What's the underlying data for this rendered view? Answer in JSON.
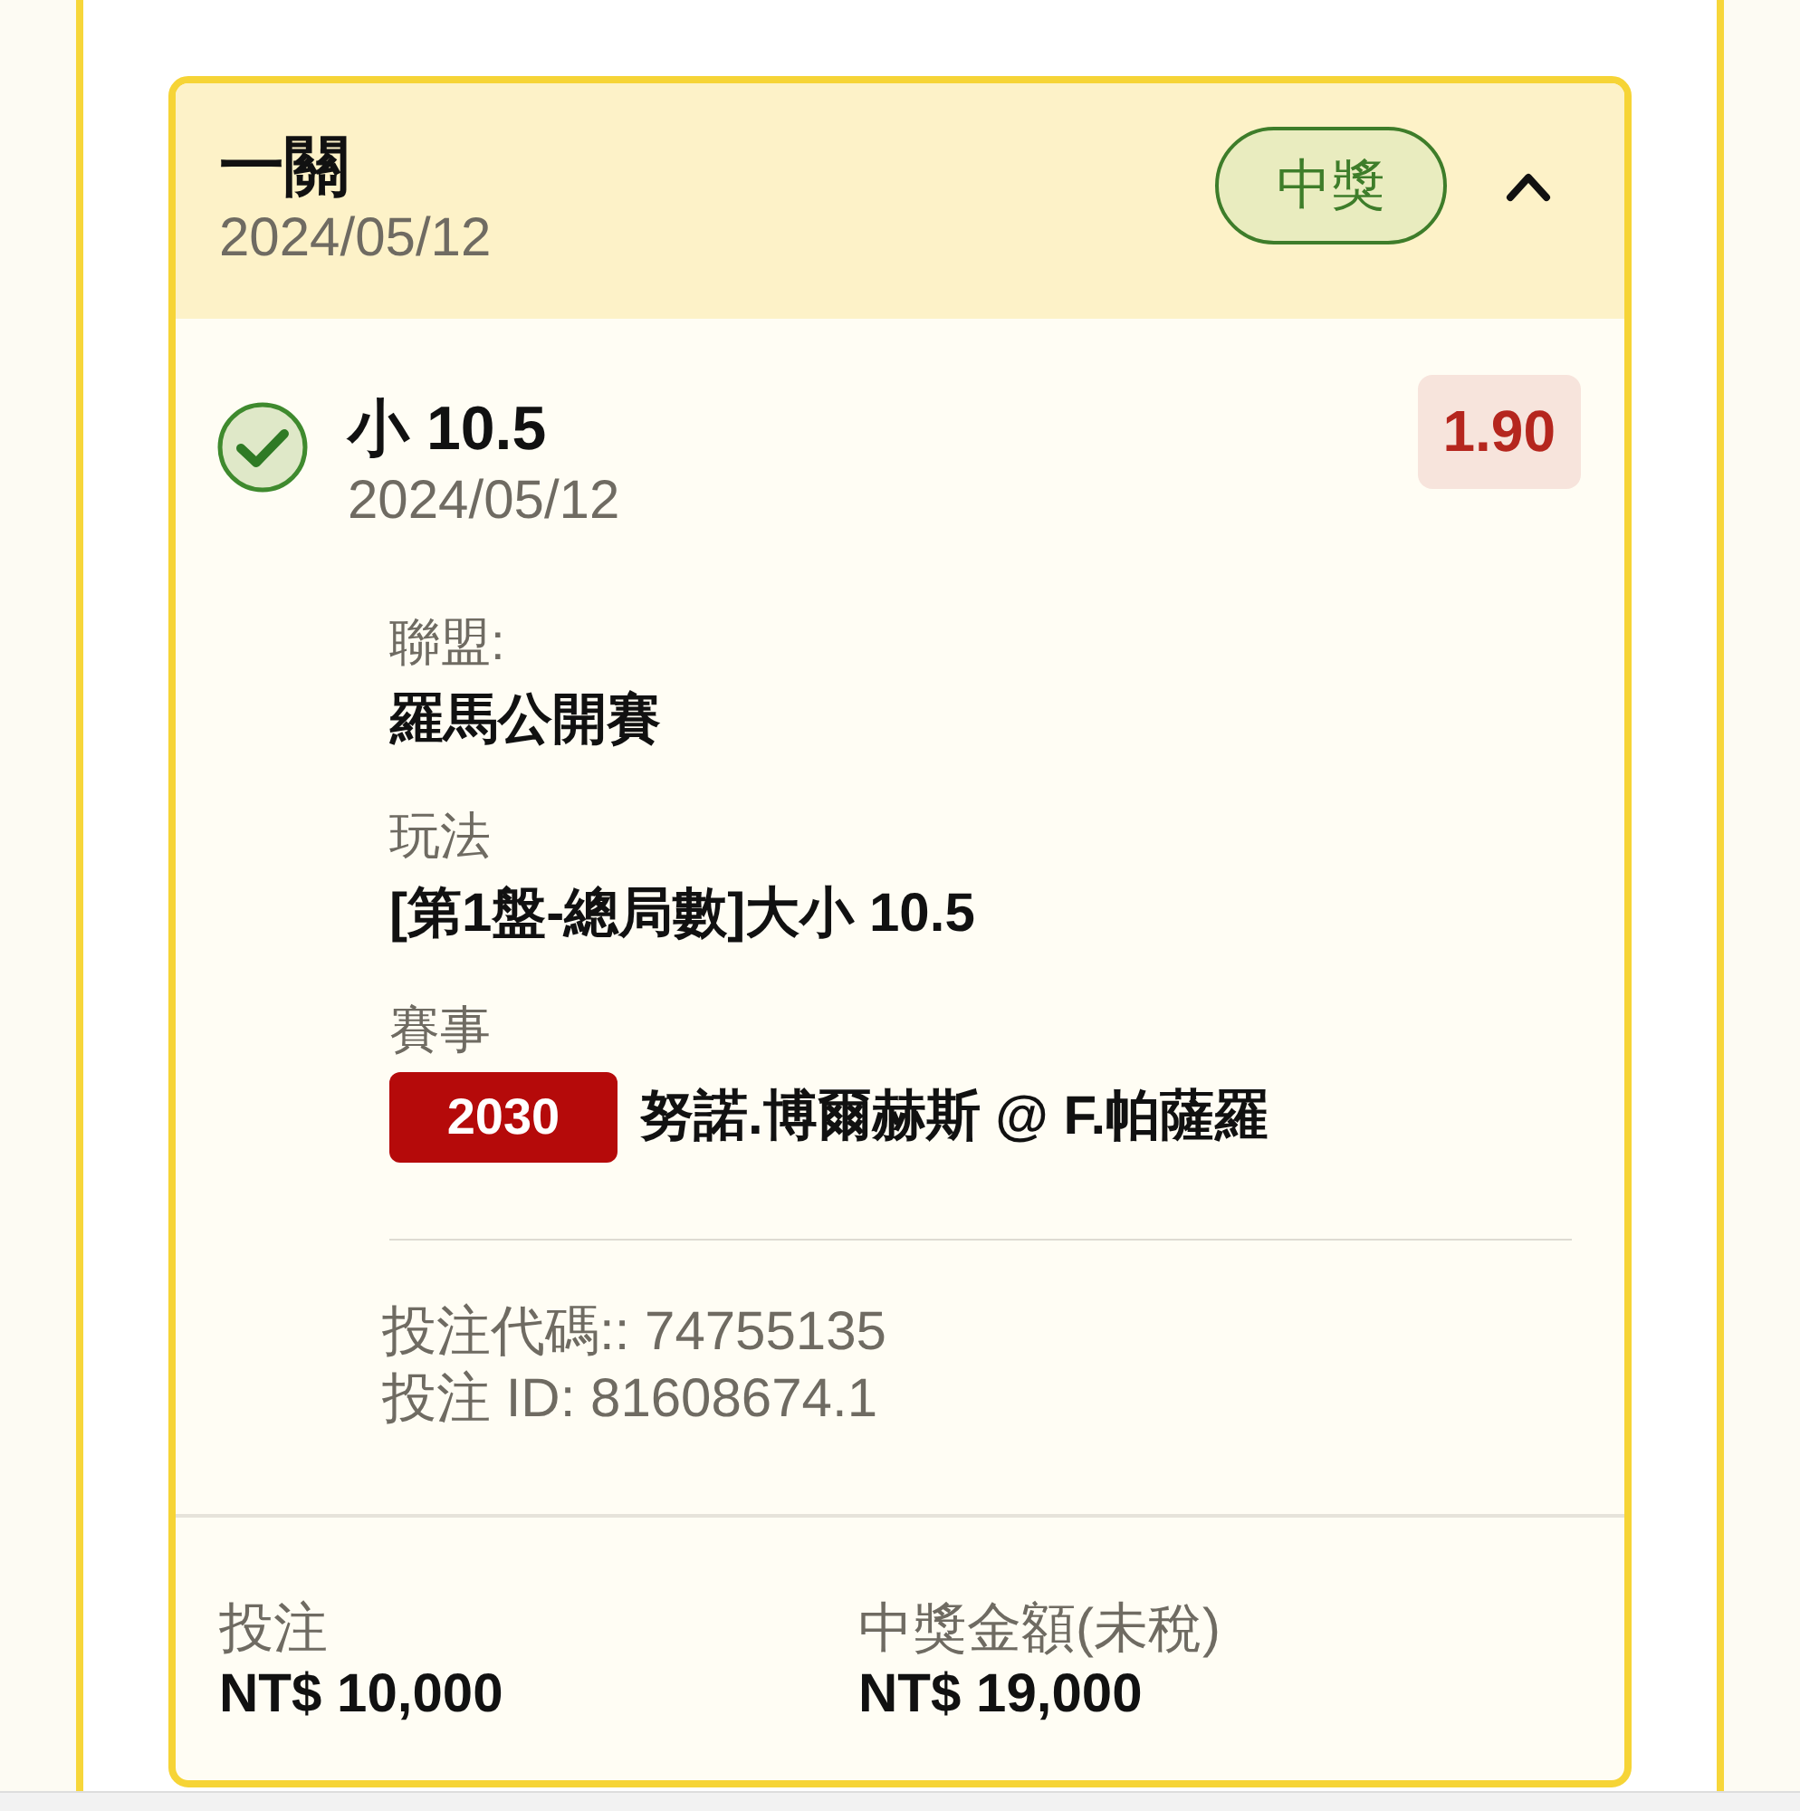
{
  "bet_card": {
    "title": "一關",
    "date": "2024/05/12",
    "status_badge": "中獎",
    "expanded": true,
    "selection": {
      "won": true,
      "pick": "小 10.5",
      "date": "2024/05/12",
      "odds": "1.90",
      "details": [
        {
          "kind": "text",
          "label": "聯盟:",
          "value": "羅馬公開賽"
        },
        {
          "kind": "text",
          "label": "玩法",
          "value": "[第1盤-總局數]大小 10.5"
        },
        {
          "kind": "event",
          "label": "賽事",
          "event_code": "2030",
          "value": "努諾.博爾赫斯 @ F.帕薩羅"
        }
      ],
      "references": [
        "投注代碼:: 74755135",
        "投注 ID: 81608674.1"
      ]
    },
    "totals": [
      {
        "label": "投注",
        "value": "NT$ 10,000"
      },
      {
        "label": "中獎金額(未稅)",
        "value": "NT$ 19,000"
      }
    ]
  }
}
